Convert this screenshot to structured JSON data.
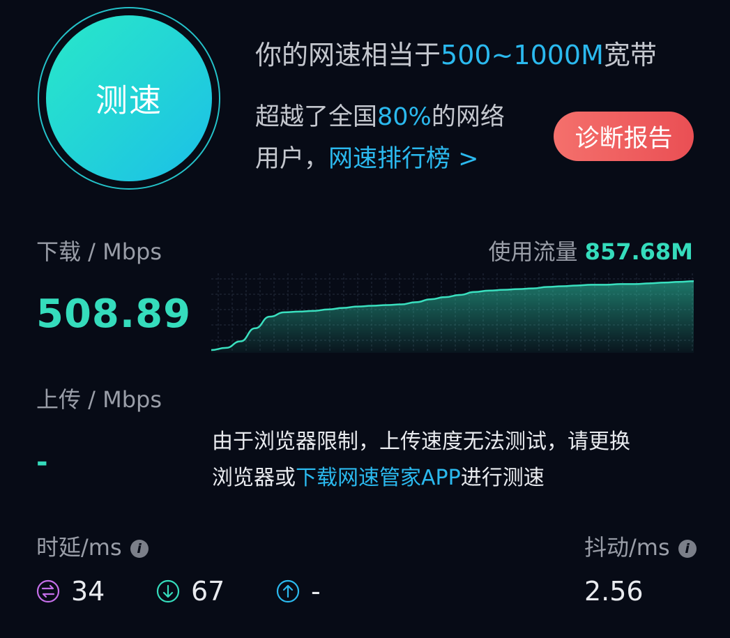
{
  "speedtest": {
    "button_label": "测速"
  },
  "result": {
    "headline_prefix": "你的网速相当于",
    "headline_range": "500~1000M",
    "headline_suffix": "宽带",
    "beat_prefix": "超越了全国",
    "beat_percent": "80%",
    "beat_suffix": "的网络",
    "beat_line2": "用户，",
    "ranking_link": "网速排行榜 >",
    "diagnose_button": "诊断报告"
  },
  "download": {
    "label": "下载 / Mbps",
    "value": "508.89"
  },
  "traffic": {
    "label": "使用流量",
    "value": "857.68M"
  },
  "upload": {
    "label": "上传 / Mbps",
    "value": "-"
  },
  "notice": {
    "line1": "由于浏览器限制，上传速度无法测试，请更换",
    "line2_prefix": "浏览器或",
    "link": "下载网速管家APP",
    "line2_suffix": "进行测速"
  },
  "latency": {
    "label": "时延/ms",
    "info_icon": "i",
    "idle": "34",
    "download": "67",
    "upload": "-"
  },
  "jitter": {
    "label": "抖动/ms",
    "info_icon": "i",
    "value": "2.56"
  },
  "colors": {
    "background": "#070b16",
    "accent_green": "#35dcbc",
    "accent_blue": "#2bb9ee",
    "diagnose_red": "#ee5b5d",
    "latency_idle_icon": "#c46ee8",
    "latency_down_icon": "#35dcbc",
    "latency_up_icon": "#2bb9ee"
  },
  "chart_data": {
    "type": "area",
    "series": [
      {
        "values": [
          0.0,
          0.03,
          0.12,
          0.3,
          0.46,
          0.52,
          0.53,
          0.54,
          0.56,
          0.58,
          0.6,
          0.61,
          0.62,
          0.63,
          0.66,
          0.7,
          0.73,
          0.76,
          0.8,
          0.82,
          0.83,
          0.84,
          0.85,
          0.87,
          0.88,
          0.89,
          0.9,
          0.9,
          0.91,
          0.91,
          0.92,
          0.93,
          0.94,
          0.95
        ]
      }
    ],
    "ylim": [
      0,
      1
    ],
    "grid": true
  }
}
